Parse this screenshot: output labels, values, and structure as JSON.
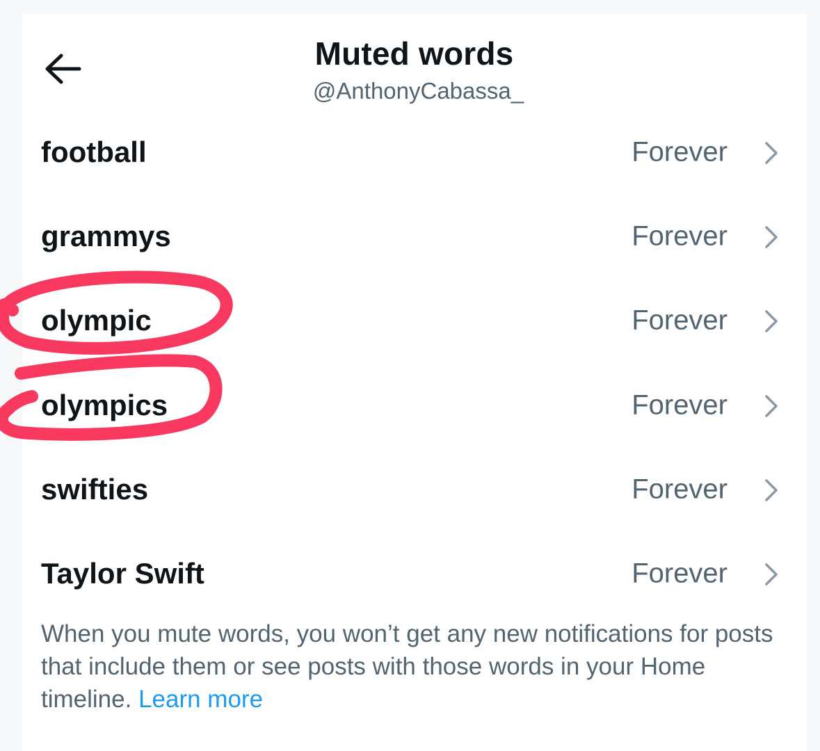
{
  "header": {
    "title": "Muted words",
    "handle": "@AnthonyCabassa_",
    "back_icon": "arrow-left-icon"
  },
  "muted_words": [
    {
      "word": "football",
      "duration": "Forever"
    },
    {
      "word": "grammys",
      "duration": "Forever"
    },
    {
      "word": "olympic",
      "duration": "Forever"
    },
    {
      "word": "olympics",
      "duration": "Forever"
    },
    {
      "word": "swifties",
      "duration": "Forever"
    },
    {
      "word": "Taylor Swift",
      "duration": "Forever"
    }
  ],
  "footer": {
    "note": "When you mute words, you won’t get any new notifications for posts that include them or see posts with those words in your Home timeline.",
    "learn_more": "Learn more"
  },
  "annotation": {
    "highlighted_words": [
      "olympic",
      "olympics"
    ]
  },
  "colors": {
    "text_primary": "#0f1419",
    "text_secondary": "#536471",
    "link": "#1d9bf0",
    "chevron": "#8b98a5",
    "annotation_stroke": "#f8385e"
  }
}
